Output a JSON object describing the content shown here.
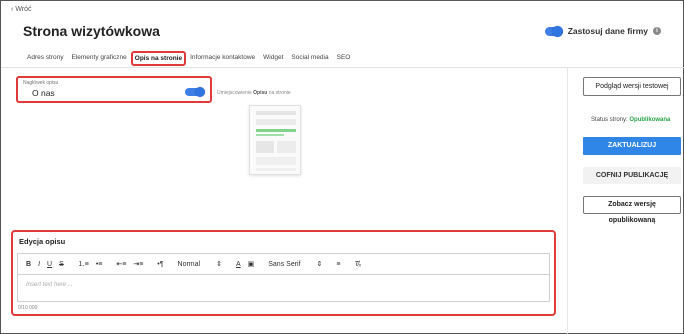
{
  "header": {
    "back_label": "Wróć",
    "page_title": "Strona wizytówkowa",
    "company_toggle_label": "Zastosuj dane firmy"
  },
  "tabs": [
    {
      "label": "Adres strony"
    },
    {
      "label": "Elementy graficzne"
    },
    {
      "label": "Opis na stronie"
    },
    {
      "label": "Informacje kontaktowe"
    },
    {
      "label": "Widget"
    },
    {
      "label": "Social media"
    },
    {
      "label": "SEO"
    }
  ],
  "description_header": {
    "field_label": "Nagłówek opisu",
    "value": "O nas",
    "toggle_on": true
  },
  "placement": {
    "prefix": "Umiejscowienie",
    "bold": "Opisu",
    "suffix": "na stronie"
  },
  "sidebar": {
    "preview_label": "Podgląd wersji testowej",
    "status_label": "Status strony:",
    "status_value": "Opublikowana",
    "update_label": "ZAKTUALIZUJ",
    "revert_label": "COFNIJ PUBLIKACJĘ",
    "see_published_label": "Zobacz wersję opublikowaną"
  },
  "editor": {
    "title": "Edycja opisu",
    "placeholder": "Insert text here ...",
    "counter": "0/10 000",
    "toolbar": {
      "bold": "B",
      "italic": "I",
      "underline": "U",
      "strike": "S",
      "heading_select": "Normal",
      "font_select": "Sans Serif",
      "text_color": "A"
    }
  },
  "colors": {
    "accent": "#2f86e6",
    "highlight": "#e03a3a",
    "status_ok": "#2aa34a"
  }
}
